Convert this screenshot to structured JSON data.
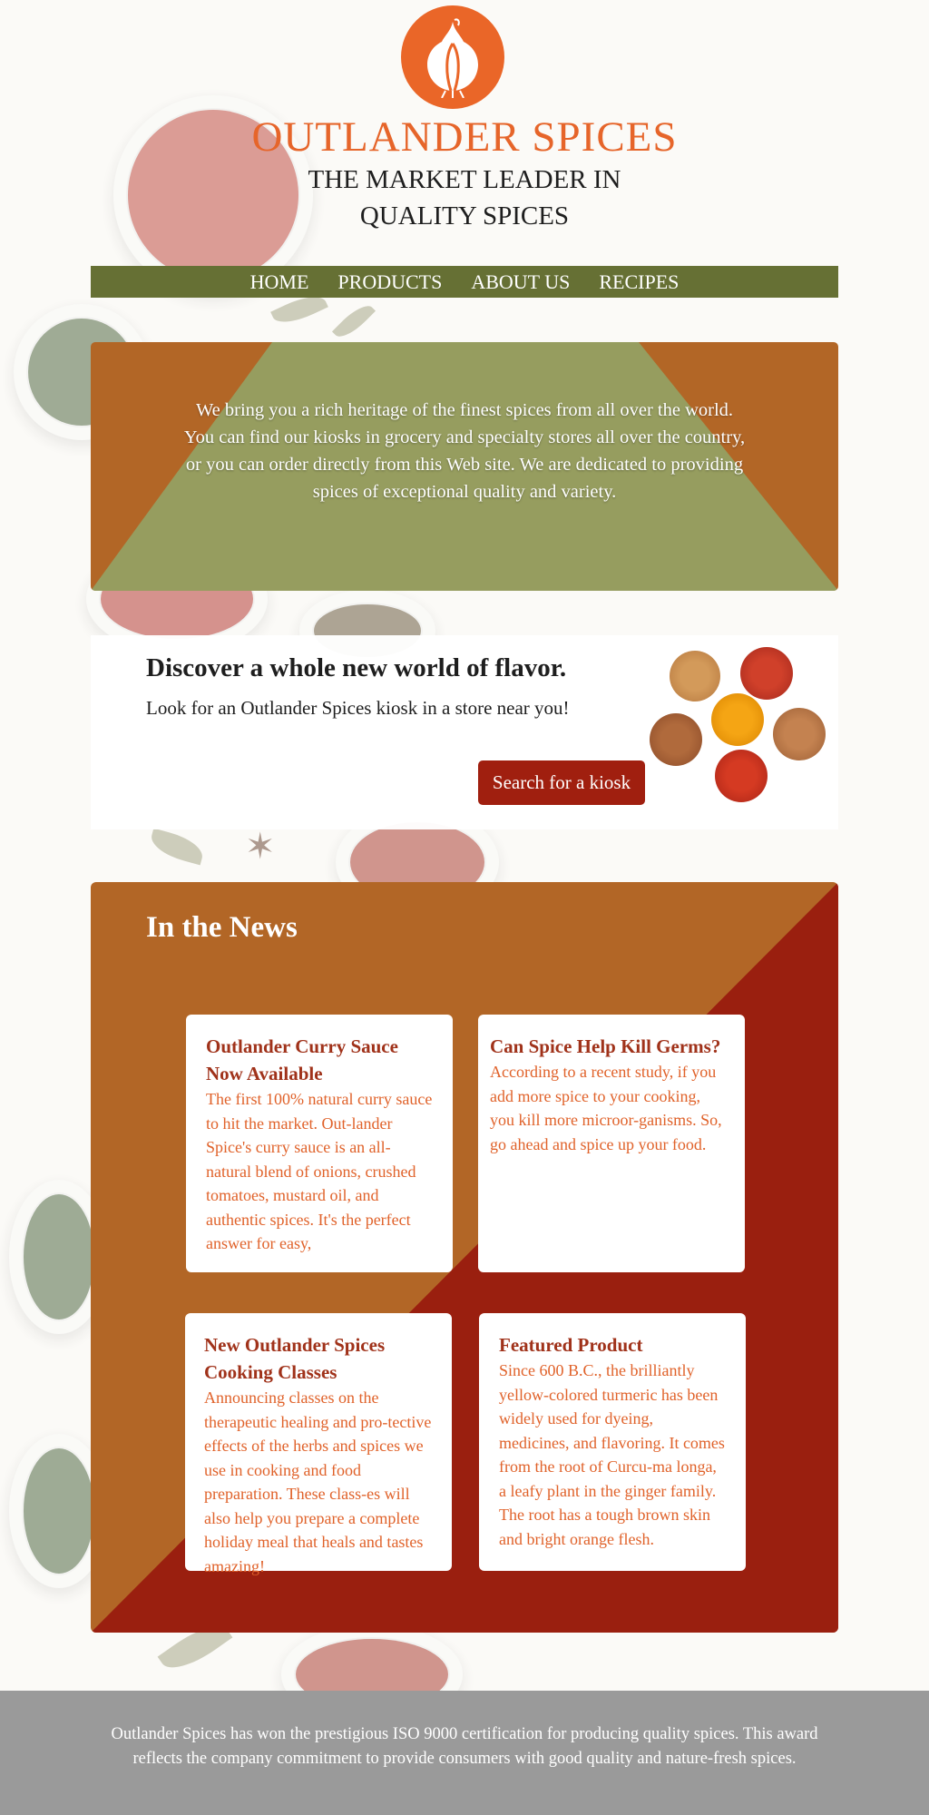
{
  "brand": {
    "name": "OUTLANDER SPICES",
    "tagline_line1": "THE MARKET LEADER IN",
    "tagline_line2": "QUALITY SPICES",
    "logo_icon": "garlic-icon",
    "accent_color": "#ea6628"
  },
  "nav": {
    "items": [
      {
        "label": "HOME"
      },
      {
        "label": "PRODUCTS"
      },
      {
        "label": "ABOUT US"
      },
      {
        "label": "RECIPES"
      }
    ],
    "background": "#667034"
  },
  "intro": {
    "text": "We bring you a rich heritage of the finest spices from all over the world. You can find our kiosks in grocery and specialty stores all over the country, or you can order directly from this Web site. We are dedicated to providing spices of exceptional quality and variety."
  },
  "discover": {
    "title": "Discover a whole new world of flavor.",
    "text": "Look for an Outlander Spices kiosk in a store near you!",
    "button_label": "Search for a kiosk",
    "button_color": "#a01f0f"
  },
  "news": {
    "title": "In the News",
    "cards": [
      {
        "title": "Outlander Curry Sauce Now Available",
        "body": "The first 100% natural curry sauce to hit the market. Out-lander Spice's curry sauce is an all-natural blend of onions, crushed tomatoes, mustard oil, and authentic spices. It's the perfect answer for easy,"
      },
      {
        "title": "Can Spice Help Kill Germs?",
        "body": "According to a recent study, if you add more spice to your cooking, you kill more microor-ganisms. So, go ahead and spice up your food."
      },
      {
        "title": "New Outlander Spices Cooking Classes",
        "body": "Announcing classes on the therapeutic healing and pro-tective effects of the herbs and spices we use in cooking and food preparation. These class-es will also help you prepare a complete holiday meal that heals and tastes amazing!"
      },
      {
        "title": "Featured Product",
        "body": "Since 600 B.C., the brilliantly yellow-colored turmeric has been widely used for dyeing, medicines, and flavoring. It comes from the root of Curcu-ma longa, a leafy plant in the ginger family. The root has a tough brown skin and bright orange flesh."
      }
    ]
  },
  "footer": {
    "text": "Outlander Spices has won the prestigious ISO 9000 certification for producing quality spices. This award reflects the company commitment to provide consumers with good quality and nature-fresh spices."
  }
}
